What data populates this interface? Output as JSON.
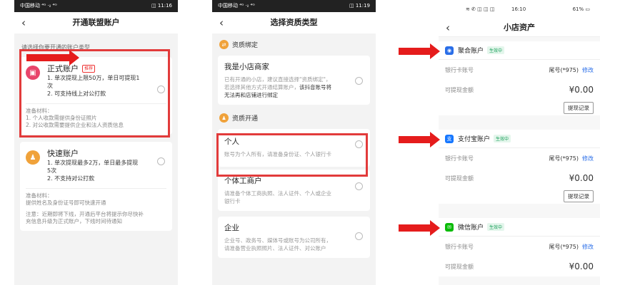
{
  "phone1": {
    "status": {
      "left": "中国移动 ⁴ᴳ ⋅ᵢₗ ⁴ᴳ",
      "right": "◫ 11:16"
    },
    "title": "开通联盟账户",
    "hint": "请选择你要开通的账户类型",
    "formal": {
      "title": "正式账户",
      "tag": "推荐",
      "line1": "1. 单次提现上限50万，单日可提现1",
      "line2": "次",
      "line3": "2. 可支持线上对公打款",
      "prep1": "准备材料：",
      "prep2": "1. 个人收款需提供身份证照片",
      "prep3": "2. 对公收款需要提供企业和法人资质信息"
    },
    "fast": {
      "title": "快速账户",
      "line1": "1. 单次提现最多2万，单日最多提现",
      "line2": "5次",
      "line3": "2. 不支持对公打款",
      "prep1": "准备材料：",
      "prep2": "提供姓名及身份证号即可快速开通",
      "note1": "注意：近期即将下线，开通后平台将提示你尽快补",
      "note2": "充信息升级为正式账户，下线时间待通知"
    }
  },
  "phone2": {
    "status": {
      "left": "中国移动 ⁴ᴳ ⋅ᵢₗ ⁴ᴳ",
      "right": "◫ 11:19"
    },
    "title": "选择资质类型",
    "sec1": "资质绑定",
    "bind": {
      "title": "我是小店商家",
      "desc1": "已有开通的小店，建议直接选择\"资质绑定\"，",
      "desc2": "若选择其他方式开通结算账户，",
      "desc2b": "该抖音账号将",
      "desc3": "无法再和店铺进行绑定"
    },
    "sec2": "资质开通",
    "personal": {
      "title": "个人",
      "desc": "账号为个人所有，请准备身份证、个人银行卡"
    },
    "individual": {
      "title": "个体工商户",
      "desc1": "请准备个体工商执照、法人证件、个人或企业",
      "desc2": "银行卡"
    },
    "enterprise": {
      "title": "企业",
      "desc1": "企业号、政务号、媒体号或账号为公司所有，",
      "desc2": "请准备营业执照照片、法人证件、对公账户"
    }
  },
  "phone3": {
    "status": {
      "left": "≋ ✆ ◫ ◫ ◫",
      "time": "16:10",
      "right": "61% ▭"
    },
    "title": "小店资产",
    "bank_label": "银行卡账号",
    "withdraw_label": "可提现金额",
    "card_suffix": "尾号(*975)",
    "edit": "修改",
    "amount": "¥0.00",
    "record": "提现记录",
    "active": "生效中",
    "accounts": [
      {
        "name": "聚合账户",
        "icon": "aggregate-icon"
      },
      {
        "name": "支付宝账户",
        "icon": "alipay-icon"
      },
      {
        "name": "微信账户",
        "icon": "wechat-icon"
      }
    ]
  },
  "colors": {
    "annotation": "#e23b3b",
    "alipay": "#1677ff",
    "wechat": "#09bb07",
    "aggregate": "#2a6ee8",
    "formal": "#e8456b",
    "fast": "#f0a23a"
  }
}
